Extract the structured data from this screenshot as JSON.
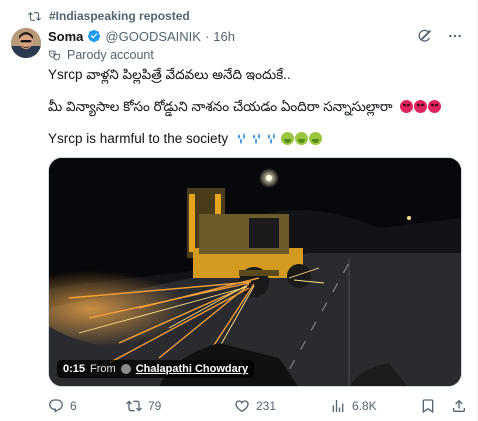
{
  "repost": {
    "label": "#Indiaspeaking reposted",
    "icon": "repost-icon"
  },
  "author": {
    "name": "Soma",
    "handle": "@GOODSAINIK",
    "separator": "·",
    "time": "16h",
    "label": "Parody account",
    "label_icon": "theater-masks-icon",
    "verified_color": "#1d9bf0"
  },
  "header_actions": [
    "grok-icon",
    "more-icon"
  ],
  "tweet": {
    "line1": "Ysrcp వాళ్లని పిల్లపిత్రే వేదవలు అనేది ఇందుకే..",
    "line2": "మీ విన్యాసాల కోసం రోడ్డుని నాశనం చేయడం ఏందిరా సన్నాసుల్లారా",
    "line3": "Ysrcp is harmful to the society"
  },
  "media": {
    "duration": "0:15",
    "from_label": "From",
    "source": "Chalapathi Chowdary"
  },
  "actions": {
    "replies": "6",
    "reposts": "79",
    "likes": "231",
    "views": "6.8K"
  },
  "colors": {
    "text": "#0f1419",
    "muted": "#536471",
    "accent": "#1d9bf0",
    "sparks": "#ff9a2e"
  }
}
